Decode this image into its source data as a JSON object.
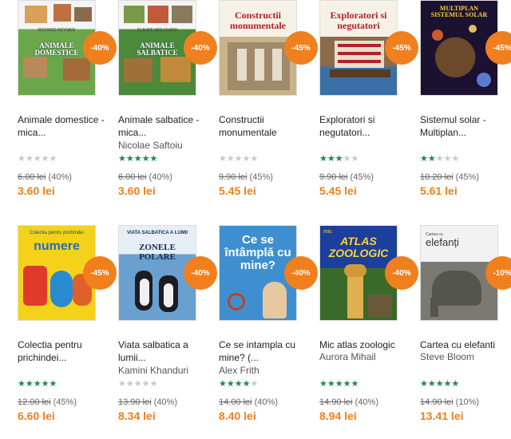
{
  "currency": "lei",
  "products": [
    {
      "cover_title": "ANIMALE DOMESTICE",
      "cover_top": "RICHARD REYNIER",
      "title": "Animale domestice - mica...",
      "author": "",
      "rating": 0,
      "old_price": "6.00 lei",
      "discount_text": "(40%)",
      "price": "3.60 lei",
      "badge": "-40%"
    },
    {
      "cover_title": "ANIMALE SALBATICE",
      "cover_top": "CLAUDE WOLFGARD",
      "title": "Animale salbatice - mica...",
      "author": "Nicolae Saftoiu",
      "rating": 5,
      "old_price": "6.00 lei",
      "discount_text": "(40%)",
      "price": "3.60 lei",
      "badge": "-40%"
    },
    {
      "cover_title": "Constructii monumentale",
      "cover_top": "",
      "title": "Constructii monumentale",
      "author": "",
      "rating": 0,
      "old_price": "9.90 lei",
      "discount_text": "(45%)",
      "price": "5.45 lei",
      "badge": "-45%"
    },
    {
      "cover_title": "Exploratori si negutatori",
      "cover_top": "",
      "title": "Exploratori si negutatori...",
      "author": "",
      "rating": 3,
      "old_price": "9.90 lei",
      "discount_text": "(45%)",
      "price": "5.45 lei",
      "badge": "-45%"
    },
    {
      "cover_title": "MULTIPLAN SISTEMUL SOLAR",
      "cover_top": "",
      "title": "Sistemul solar - Multiplan...",
      "author": "",
      "rating": 2,
      "old_price": "10.20 lei",
      "discount_text": "(45%)",
      "price": "5.61 lei",
      "badge": "-45%"
    },
    {
      "cover_title": "numere",
      "cover_top": "Colectia pentru prichindei",
      "title": "Colectia pentru prichindei...",
      "author": "",
      "rating": 5,
      "old_price": "12.00 lei",
      "discount_text": "(45%)",
      "price": "6.60 lei",
      "badge": "-45%"
    },
    {
      "cover_title": "ZONELE POLARE",
      "cover_top": "VIATA SALBATICA A LUMII",
      "title": "Viata salbatica a lumii...",
      "author": "Kamini Khanduri",
      "rating": 0,
      "old_price": "13.90 lei",
      "discount_text": "(40%)",
      "price": "8.34 lei",
      "badge": "-40%"
    },
    {
      "cover_title": "Ce se întâmplă cu mine?",
      "cover_top": "",
      "title": "Ce se intampla cu mine? (...",
      "author": "Alex Frith",
      "rating": 4,
      "old_price": "14.00 lei",
      "discount_text": "(40%)",
      "price": "8.40 lei",
      "badge": "-40%"
    },
    {
      "cover_title": "ATLAS ZOOLOGIC",
      "cover_top": "mic",
      "title": "Mic atlas zoologic",
      "author": "Aurora Mihail",
      "rating": 5,
      "old_price": "14.90 lei",
      "discount_text": "(40%)",
      "price": "8.94 lei",
      "badge": "-40%"
    },
    {
      "cover_title": "elefanți",
      "cover_top": "Cartea cu",
      "title": "Cartea cu elefanti",
      "author": "Steve Bloom",
      "rating": 5,
      "old_price": "14.90 lei",
      "discount_text": "(10%)",
      "price": "13.41 lei",
      "badge": "-10%"
    }
  ]
}
